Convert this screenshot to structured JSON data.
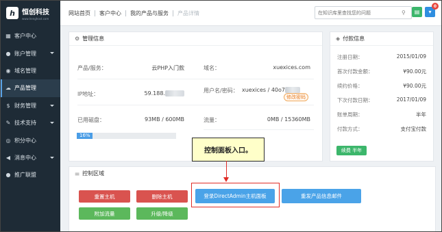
{
  "brand": {
    "name": "恒创科技",
    "sub": "www.henghost.com"
  },
  "sidebar": {
    "items": [
      {
        "label": "客户中心",
        "icon": "grid-icon",
        "caret": false
      },
      {
        "label": "账户管理",
        "icon": "user-icon",
        "caret": true
      },
      {
        "label": "域名管理",
        "icon": "globe-icon",
        "caret": false
      },
      {
        "label": "产品管理",
        "icon": "cloud-icon",
        "caret": false,
        "active": true
      },
      {
        "label": "财务管理",
        "icon": "money-icon",
        "caret": true
      },
      {
        "label": "技术支持",
        "icon": "wrench-icon",
        "caret": true
      },
      {
        "label": "积分中心",
        "icon": "coin-icon",
        "caret": false
      },
      {
        "label": "消息中心",
        "icon": "megaphone-icon",
        "caret": true
      },
      {
        "label": "推广联盟",
        "icon": "circle-icon",
        "caret": false
      }
    ]
  },
  "topbar": {
    "crumbs": [
      "网站首页",
      "客户中心",
      "我的产品与服务",
      "产品详情"
    ],
    "search_placeholder": "在知识库里查找您的问题",
    "cart_count": "0"
  },
  "management": {
    "title": "管理信息",
    "product_label": "产品/服务：",
    "product_value": "云PHP入门款",
    "domain_label": "域名：",
    "domain_value": "xuexices.com",
    "ip_label": "IP地址：",
    "ip_value": "59.188.",
    "account_label": "用户名/密码：",
    "account_value": "xuexices / 40o7",
    "change_pwd": "修改密码",
    "disk_label": "已用磁盘：",
    "disk_value": "93MB / 600MB",
    "traffic_label": "流量：",
    "traffic_value": "0MB / 15360MB",
    "disk_percent_label": "16%",
    "disk_fraction": 0.16
  },
  "payment": {
    "title": "付款信息",
    "rows": [
      {
        "k": "注册日期：",
        "v": "2015/01/09"
      },
      {
        "k": "首次付款金额：",
        "v": "¥90.00元"
      },
      {
        "k": "续约价格：",
        "v": "¥90.00元"
      },
      {
        "k": "下次付款日期：",
        "v": "2017/01/09"
      },
      {
        "k": "账单周期：",
        "v": "半年"
      },
      {
        "k": "付款方式：",
        "v": "支付宝付款"
      }
    ],
    "renew_label": "续费 半年"
  },
  "control": {
    "title": "控制区域",
    "reset_host": "重置主机",
    "delete_host": "删除主机",
    "login_panel": "登录DirectAdmin主机面板",
    "resend_email": "重发产品信息邮件",
    "add_traffic": "附加流量",
    "upgrade": "升级/降级"
  },
  "annotation": {
    "text": "控制面板入口。"
  }
}
